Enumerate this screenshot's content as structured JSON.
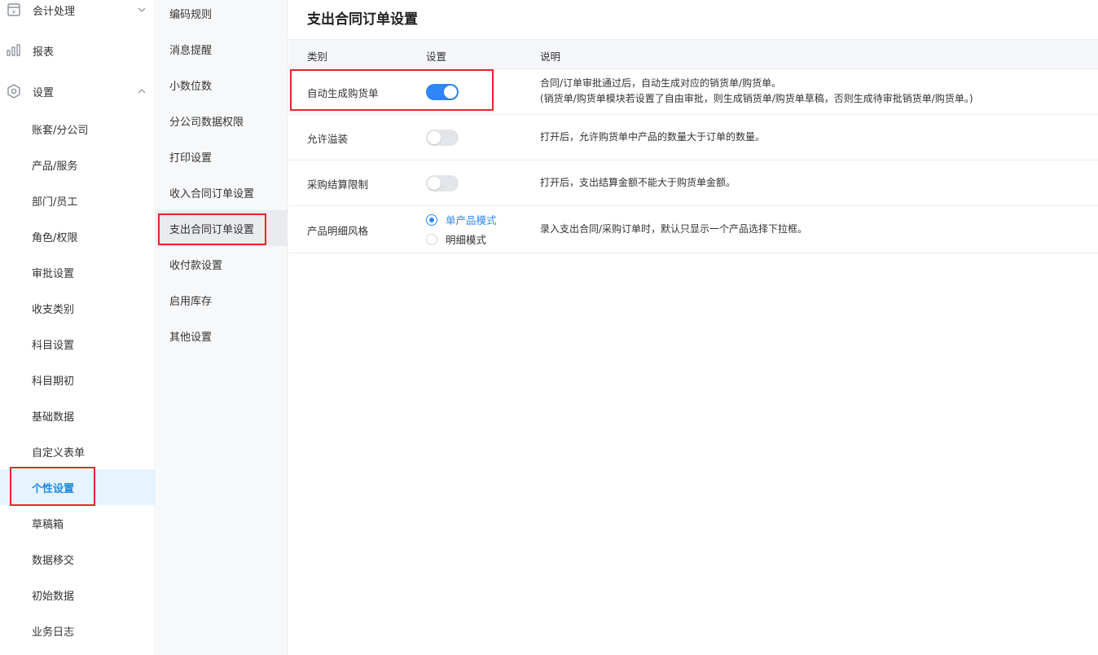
{
  "sidebar": {
    "groups": [
      {
        "label": "会计处理",
        "icon": "ledger-icon"
      },
      {
        "label": "报表",
        "icon": "bar-chart-icon"
      },
      {
        "label": "设置",
        "icon": "settings-hex-icon"
      }
    ],
    "items": [
      {
        "label": "账套/分公司"
      },
      {
        "label": "产品/服务"
      },
      {
        "label": "部门/员工"
      },
      {
        "label": "角色/权限"
      },
      {
        "label": "审批设置"
      },
      {
        "label": "收支类别"
      },
      {
        "label": "科目设置"
      },
      {
        "label": "科目期初"
      },
      {
        "label": "基础数据"
      },
      {
        "label": "自定义表单"
      },
      {
        "label": "个性设置",
        "active": true
      },
      {
        "label": "草稿箱"
      },
      {
        "label": "数据移交"
      },
      {
        "label": "初始数据"
      },
      {
        "label": "业务日志"
      }
    ]
  },
  "midnav": {
    "items": [
      {
        "label": "编码规则"
      },
      {
        "label": "消息提醒"
      },
      {
        "label": "小数位数"
      },
      {
        "label": "分公司数据权限"
      },
      {
        "label": "打印设置"
      },
      {
        "label": "收入合同订单设置"
      },
      {
        "label": "支出合同订单设置",
        "active": true
      },
      {
        "label": "收付款设置"
      },
      {
        "label": "启用库存"
      },
      {
        "label": "其他设置"
      }
    ]
  },
  "main": {
    "title": "支出合同订单设置",
    "columns": {
      "category": "类别",
      "setting": "设置",
      "description": "说明"
    },
    "rows": [
      {
        "category": "自动生成购货单",
        "toggle_on": true,
        "desc_line1": "合同/订单审批通过后，自动生成对应的销货单/购货单。",
        "desc_line2": "(销货单/购货单模块若设置了自由审批，则生成销货单/购货单草稿，否则生成待审批销货单/购货单。)"
      },
      {
        "category": "允许溢装",
        "toggle_on": false,
        "desc_line1": "打开后，允许购货单中产品的数量大于订单的数量。"
      },
      {
        "category": "采购结算限制",
        "toggle_on": false,
        "desc_line1": "打开后，支出结算金额不能大于购货单金额。"
      },
      {
        "category": "产品明细风格",
        "options": [
          {
            "label": "单产品模式",
            "selected": true
          },
          {
            "label": "明细模式",
            "selected": false
          }
        ],
        "desc_line1": "录入支出合同/采购订单时，默认只显示一个产品选择下拉框。"
      }
    ]
  },
  "colors": {
    "accent": "#2f86f6",
    "active_text": "#1e88e5",
    "active_bg": "#e6f4ff",
    "highlight_box": "#e8262b"
  }
}
